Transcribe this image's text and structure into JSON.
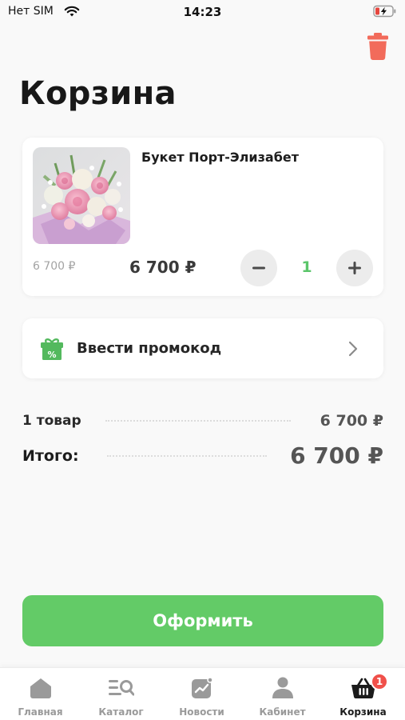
{
  "status_bar": {
    "carrier": "Нет SIM",
    "time": "14:23"
  },
  "header": {
    "title": "Корзина",
    "delete_icon": "trash-icon"
  },
  "cart": {
    "items": [
      {
        "name": "Букет Порт-Элизабет",
        "old_price": "6 700 ₽",
        "price": "6 700 ₽",
        "quantity": "1",
        "decrement_label": "−",
        "increment_label": "+"
      }
    ]
  },
  "promo": {
    "label": "Ввести промокод",
    "icon": "gift-percent-icon",
    "icon_glyph": "%"
  },
  "summary": {
    "items_label": "1 товар",
    "items_value": "6 700 ₽",
    "total_label": "Итого:",
    "total_value": "6 700 ₽"
  },
  "checkout": {
    "label": "Оформить"
  },
  "tabs": [
    {
      "label": "Главная",
      "icon": "home-icon"
    },
    {
      "label": "Каталог",
      "icon": "catalog-search-icon"
    },
    {
      "label": "Новости",
      "icon": "news-icon"
    },
    {
      "label": "Кабинет",
      "icon": "user-icon"
    },
    {
      "label": "Корзина",
      "icon": "basket-icon",
      "active": true,
      "badge": "1"
    }
  ],
  "colors": {
    "accent_green": "#63cb67",
    "quantity_green": "#5bc56a",
    "trash_red": "#f26b5b",
    "badge_red": "#f0504a"
  }
}
